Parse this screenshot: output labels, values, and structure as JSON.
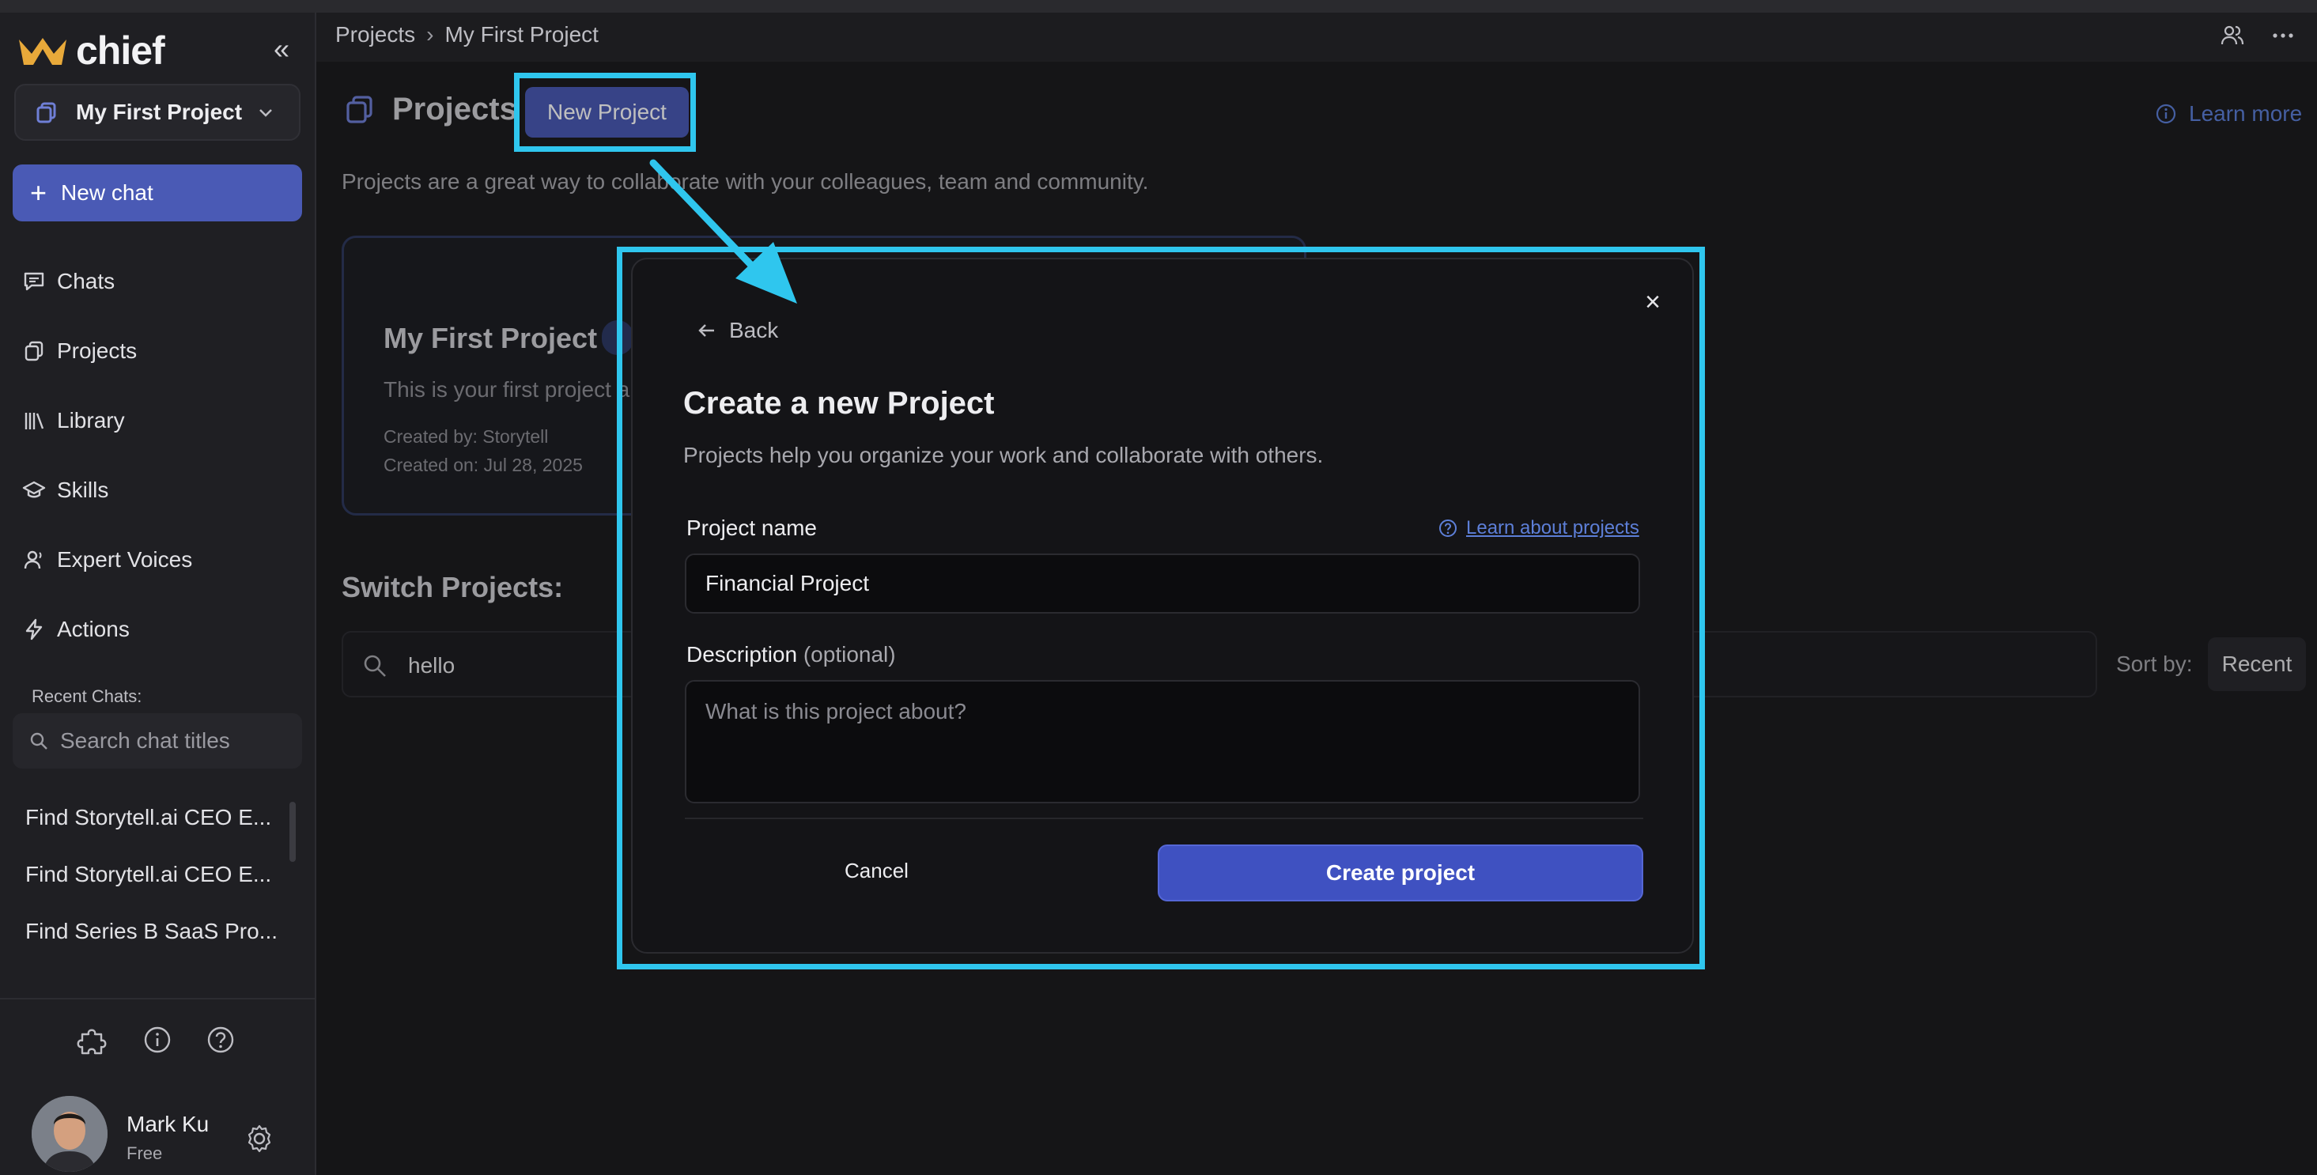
{
  "app": {
    "brand": "chief"
  },
  "sidebar": {
    "project_selector": "My First Project",
    "new_chat": "New chat",
    "nav": [
      {
        "label": "Chats",
        "icon": "chat-bubble-icon"
      },
      {
        "label": "Projects",
        "icon": "projects-icon"
      },
      {
        "label": "Library",
        "icon": "library-icon"
      },
      {
        "label": "Skills",
        "icon": "graduation-cap-icon"
      },
      {
        "label": "Expert Voices",
        "icon": "person-voice-icon"
      },
      {
        "label": "Actions",
        "icon": "lightning-icon"
      }
    ],
    "recent_title": "Recent Chats:",
    "search_placeholder": "Search chat titles",
    "recent_chats": [
      "Find Storytell.ai CEO E...",
      "Find Storytell.ai CEO E...",
      "Find Series B SaaS Pro..."
    ],
    "user": {
      "name": "Mark Ku",
      "plan": "Free"
    }
  },
  "breadcrumb": {
    "root": "Projects",
    "current": "My First Project"
  },
  "main": {
    "title": "Projects",
    "new_project": "New Project",
    "learn_more": "Learn more",
    "subtitle": "Projects are a great way to collaborate with your colleagues, team and community.",
    "card": {
      "title": "My First Project",
      "desc": "This is your first project a",
      "created_by": "Created by: Storytell",
      "created_on": "Created on: Jul 28, 2025"
    },
    "switch_title": "Switch Projects:",
    "search_value": "hello",
    "sort_label": "Sort by:",
    "sort_value": "Recent"
  },
  "modal": {
    "close": "×",
    "back": "Back",
    "heading": "Create a new Project",
    "intro": "Projects help you organize your work and collaborate with others.",
    "name_label": "Project name",
    "learn_link": "Learn about projects",
    "name_value": "Financial Project",
    "desc_label": "Description",
    "desc_optional": "(optional)",
    "desc_placeholder": "What is this project about?",
    "cancel": "Cancel",
    "create": "Create project"
  },
  "colors": {
    "accent": "#4a5ab5",
    "highlight": "#2fc6ee",
    "link": "#5d7fd8"
  }
}
